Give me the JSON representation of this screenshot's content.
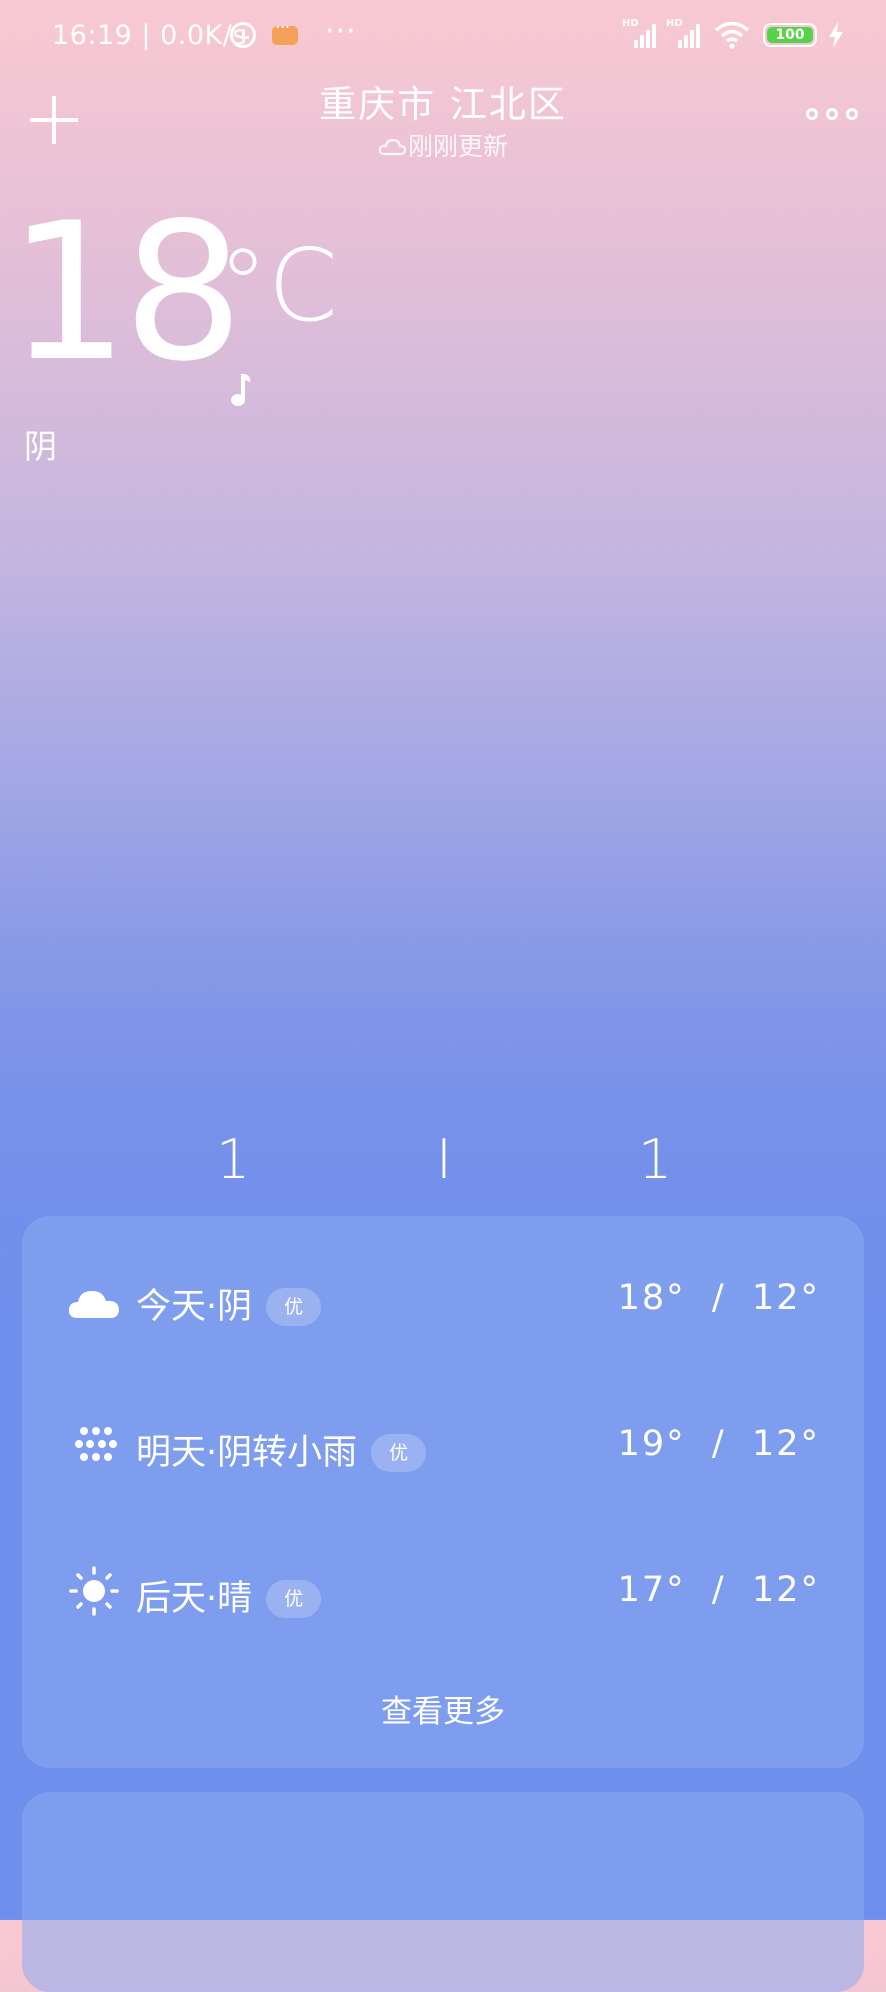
{
  "status_bar": {
    "text": "16:19 | 0.0K/s",
    "more": "···",
    "hd1": "HD",
    "hd2": "HD",
    "battery": "100",
    "icons": [
      "alarm-icon",
      "message-icon",
      "signal-icon",
      "signal-icon",
      "wifi-icon",
      "battery-icon",
      "charge-icon"
    ],
    "battery_color": "#56d34a",
    "message_color": "#f4a15a"
  },
  "header": {
    "city": "重庆市  江北区",
    "update_status": "刚刚更新",
    "icons": [
      "add-icon",
      "cloud-icon",
      "menu-icon"
    ]
  },
  "current": {
    "temperature": "18",
    "unit": "°C",
    "condition": "阴"
  },
  "strip": [
    "1",
    "I",
    "1"
  ],
  "forecast": {
    "rows": [
      {
        "day_condition": "今天·阴",
        "aqi": "优",
        "temps": "18°  /  12°",
        "icon": "cloud-icon"
      },
      {
        "day_condition": "明天·阴转小雨",
        "aqi": "优",
        "temps": "19°  /  12°",
        "icon": "drizzle-icon"
      },
      {
        "day_condition": "后天·晴",
        "aqi": "优",
        "temps": "17°  /  12°",
        "icon": "sun-icon"
      }
    ],
    "see_more": "查看更多"
  },
  "colors": {
    "gradient_top": "#f9c9d1",
    "gradient_bottom": "#6e8fec",
    "card": "#8caaf0"
  }
}
